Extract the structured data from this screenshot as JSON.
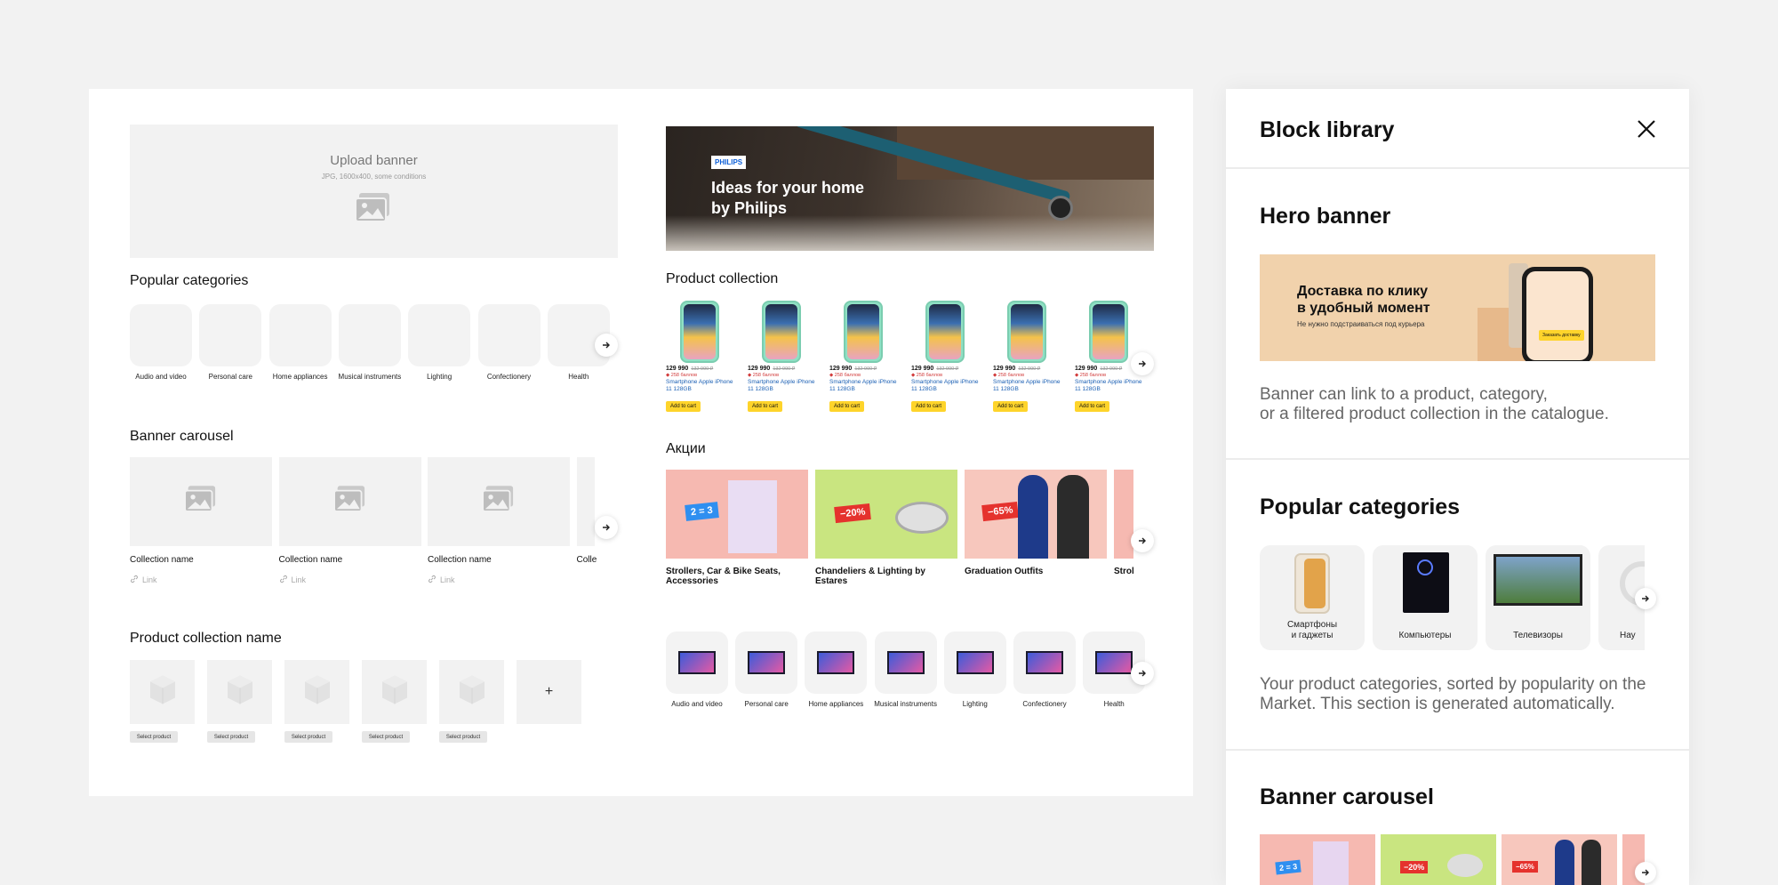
{
  "left": {
    "upload_banner": {
      "title": "Upload banner",
      "hint": "JPG, 1600x400, some conditions"
    },
    "popular_categories": {
      "title": "Popular categories",
      "items": [
        "Audio and video",
        "Personal care",
        "Home appliances",
        "Musical instruments",
        "Lighting",
        "Confectionery",
        "Health"
      ]
    },
    "banner_carousel": {
      "title": "Banner carousel",
      "items": [
        {
          "name": "Collection name",
          "link": "Link"
        },
        {
          "name": "Collection name",
          "link": "Link"
        },
        {
          "name": "Collection name",
          "link": "Link"
        },
        {
          "name": "Colle",
          "link": ""
        }
      ]
    },
    "product_collection": {
      "title": "Product collection name",
      "select_label": "Select product",
      "add_symbol": "+"
    }
  },
  "right": {
    "hero": {
      "brand": "PHILIPS",
      "headline_1": "Ideas for your home",
      "headline_2": "by Philips"
    },
    "product_collection": {
      "title": "Product collection",
      "items": [
        {
          "price": "129 990",
          "old": "132 990 ₽",
          "bonus": "258 баллов",
          "name_1": "Smartphone Apple iPhone",
          "name_2": "11 128GB",
          "cart": "Add to cart"
        },
        {
          "price": "129 990",
          "old": "132 990 ₽",
          "bonus": "258 баллов",
          "name_1": "Smartphone Apple iPhone",
          "name_2": "11 128GB",
          "cart": "Add to cart"
        },
        {
          "price": "129 990",
          "old": "132 990 ₽",
          "bonus": "258 баллов",
          "name_1": "Smartphone Apple iPhone",
          "name_2": "11 128GB",
          "cart": "Add to cart"
        },
        {
          "price": "129 990",
          "old": "132 990 ₽",
          "bonus": "258 баллов",
          "name_1": "Smartphone Apple iPhone",
          "name_2": "11 128GB",
          "cart": "Add to cart"
        },
        {
          "price": "129 990",
          "old": "132 990 ₽",
          "bonus": "258 баллов",
          "name_1": "Smartphone Apple iPhone",
          "name_2": "11 128GB",
          "cart": "Add to cart"
        },
        {
          "price": "129 990",
          "old": "132 990 ₽",
          "bonus": "258 баллов",
          "name_1": "Smartphone Apple iPhone",
          "name_2": "11 128GB",
          "cart": "Add to cart"
        }
      ]
    },
    "promos": {
      "title": "Акции",
      "items": [
        {
          "caption": "Strollers, Car & Bike Seats, Accessories",
          "badge": "2 = 3",
          "bg": "#f6b9b1"
        },
        {
          "caption": "Chandeliers & Lighting by Estares",
          "badge": "−20%",
          "bg": "#c9e580"
        },
        {
          "caption": "Graduation Outfits",
          "badge": "−65%",
          "bg": "#f7c7bd"
        },
        {
          "caption": "Strol",
          "badge": "",
          "bg": "#f6b9b1"
        }
      ]
    },
    "categories": {
      "items": [
        "Audio and video",
        "Personal care",
        "Home appliances",
        "Musical instruments",
        "Lighting",
        "Confectionery",
        "Health"
      ]
    }
  },
  "library": {
    "title": "Block library",
    "hero": {
      "title": "Hero banner",
      "banner_line1": "Доставка по клику",
      "banner_line2": "в удобный момент",
      "banner_sub": "Не нужно подстраиваться под курьера",
      "banner_button": "Заказать доставку",
      "desc_1": "Banner can link to a product, category,",
      "desc_2": "or a filtered product collection in the catalogue."
    },
    "popular": {
      "title": "Popular categories",
      "items": [
        {
          "l1": "Смартфоны",
          "l2": "и гаджеты"
        },
        {
          "l1": "Компьютеры",
          "l2": ""
        },
        {
          "l1": "Телевизоры",
          "l2": ""
        },
        {
          "l1": "Нау",
          "l2": ""
        }
      ],
      "desc_1": "Your product categories, sorted by popularity on the",
      "desc_2": "Market. This section is generated automatically."
    },
    "carousel": {
      "title": "Banner carousel",
      "badges": [
        "2 = 3",
        "−20%",
        "−65%"
      ]
    }
  },
  "colors": {
    "accent_yellow": "#fed42b",
    "link_blue": "#1a5fb4",
    "placeholder": "#f2f2f2"
  }
}
